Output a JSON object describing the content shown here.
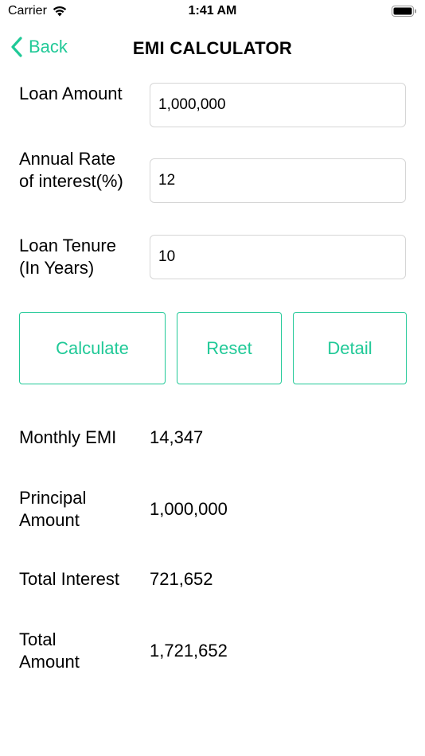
{
  "status_bar": {
    "carrier": "Carrier",
    "time": "1:41 AM"
  },
  "nav": {
    "back_label": "Back",
    "title": "EMI CALCULATOR"
  },
  "form": {
    "loan_amount": {
      "label": "Loan Amount",
      "value": "1,000,000"
    },
    "interest_rate": {
      "label": "Annual Rate of interest(%)",
      "value": "12"
    },
    "tenure": {
      "label": "Loan Tenure (In Years)",
      "value": "10"
    }
  },
  "buttons": {
    "calculate": "Calculate",
    "reset": "Reset",
    "detail": "Detail"
  },
  "results": {
    "monthly_emi": {
      "label": "Monthly EMI",
      "value": "14,347"
    },
    "principal": {
      "label": "Principal Amount",
      "value": "1,000,000"
    },
    "total_interest": {
      "label": "Total Interest",
      "value": "721,652"
    },
    "total_amount": {
      "label": "Total Amount",
      "value": "1,721,652"
    }
  },
  "colors": {
    "accent": "#20c997"
  },
  "icons": {
    "wifi": "wifi-icon",
    "battery": "battery-icon",
    "back": "chevron-left-icon"
  }
}
